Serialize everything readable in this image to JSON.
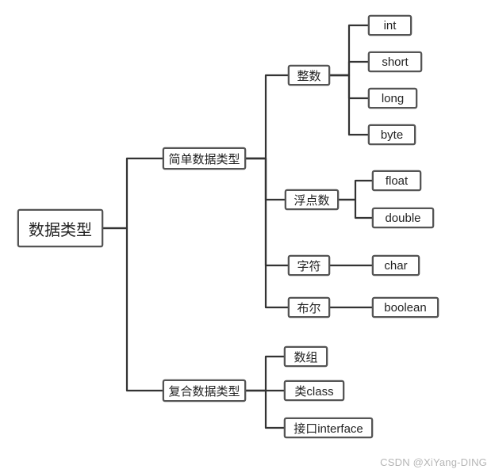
{
  "root": {
    "label": "数据类型"
  },
  "simple": {
    "label": "简单数据类型",
    "integer": {
      "label": "整数",
      "types": {
        "int": "int",
        "short": "short",
        "long": "long",
        "byte": "byte"
      }
    },
    "float": {
      "label": "浮点数",
      "types": {
        "float": "float",
        "double": "double"
      }
    },
    "char": {
      "label": "字符",
      "types": {
        "char": "char"
      }
    },
    "bool": {
      "label": "布尔",
      "types": {
        "boolean": "boolean"
      }
    }
  },
  "composite": {
    "label": "复合数据类型",
    "array": {
      "label": "数组"
    },
    "class": {
      "label": "类class"
    },
    "interface": {
      "label": "接口interface"
    }
  },
  "watermark": "CSDN @XiYang-DING"
}
